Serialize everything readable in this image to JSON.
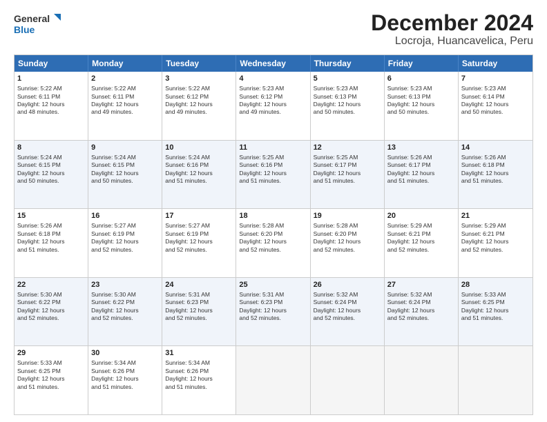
{
  "header": {
    "logo_line1": "General",
    "logo_line2": "Blue",
    "month": "December 2024",
    "location": "Locroja, Huancavelica, Peru"
  },
  "weekdays": [
    "Sunday",
    "Monday",
    "Tuesday",
    "Wednesday",
    "Thursday",
    "Friday",
    "Saturday"
  ],
  "rows": [
    [
      {
        "day": "1",
        "text": "Sunrise: 5:22 AM\nSunset: 6:11 PM\nDaylight: 12 hours\nand 48 minutes."
      },
      {
        "day": "2",
        "text": "Sunrise: 5:22 AM\nSunset: 6:11 PM\nDaylight: 12 hours\nand 49 minutes."
      },
      {
        "day": "3",
        "text": "Sunrise: 5:22 AM\nSunset: 6:12 PM\nDaylight: 12 hours\nand 49 minutes."
      },
      {
        "day": "4",
        "text": "Sunrise: 5:23 AM\nSunset: 6:12 PM\nDaylight: 12 hours\nand 49 minutes."
      },
      {
        "day": "5",
        "text": "Sunrise: 5:23 AM\nSunset: 6:13 PM\nDaylight: 12 hours\nand 50 minutes."
      },
      {
        "day": "6",
        "text": "Sunrise: 5:23 AM\nSunset: 6:13 PM\nDaylight: 12 hours\nand 50 minutes."
      },
      {
        "day": "7",
        "text": "Sunrise: 5:23 AM\nSunset: 6:14 PM\nDaylight: 12 hours\nand 50 minutes."
      }
    ],
    [
      {
        "day": "8",
        "text": "Sunrise: 5:24 AM\nSunset: 6:15 PM\nDaylight: 12 hours\nand 50 minutes."
      },
      {
        "day": "9",
        "text": "Sunrise: 5:24 AM\nSunset: 6:15 PM\nDaylight: 12 hours\nand 50 minutes."
      },
      {
        "day": "10",
        "text": "Sunrise: 5:24 AM\nSunset: 6:16 PM\nDaylight: 12 hours\nand 51 minutes."
      },
      {
        "day": "11",
        "text": "Sunrise: 5:25 AM\nSunset: 6:16 PM\nDaylight: 12 hours\nand 51 minutes."
      },
      {
        "day": "12",
        "text": "Sunrise: 5:25 AM\nSunset: 6:17 PM\nDaylight: 12 hours\nand 51 minutes."
      },
      {
        "day": "13",
        "text": "Sunrise: 5:26 AM\nSunset: 6:17 PM\nDaylight: 12 hours\nand 51 minutes."
      },
      {
        "day": "14",
        "text": "Sunrise: 5:26 AM\nSunset: 6:18 PM\nDaylight: 12 hours\nand 51 minutes."
      }
    ],
    [
      {
        "day": "15",
        "text": "Sunrise: 5:26 AM\nSunset: 6:18 PM\nDaylight: 12 hours\nand 51 minutes."
      },
      {
        "day": "16",
        "text": "Sunrise: 5:27 AM\nSunset: 6:19 PM\nDaylight: 12 hours\nand 52 minutes."
      },
      {
        "day": "17",
        "text": "Sunrise: 5:27 AM\nSunset: 6:19 PM\nDaylight: 12 hours\nand 52 minutes."
      },
      {
        "day": "18",
        "text": "Sunrise: 5:28 AM\nSunset: 6:20 PM\nDaylight: 12 hours\nand 52 minutes."
      },
      {
        "day": "19",
        "text": "Sunrise: 5:28 AM\nSunset: 6:20 PM\nDaylight: 12 hours\nand 52 minutes."
      },
      {
        "day": "20",
        "text": "Sunrise: 5:29 AM\nSunset: 6:21 PM\nDaylight: 12 hours\nand 52 minutes."
      },
      {
        "day": "21",
        "text": "Sunrise: 5:29 AM\nSunset: 6:21 PM\nDaylight: 12 hours\nand 52 minutes."
      }
    ],
    [
      {
        "day": "22",
        "text": "Sunrise: 5:30 AM\nSunset: 6:22 PM\nDaylight: 12 hours\nand 52 minutes."
      },
      {
        "day": "23",
        "text": "Sunrise: 5:30 AM\nSunset: 6:22 PM\nDaylight: 12 hours\nand 52 minutes."
      },
      {
        "day": "24",
        "text": "Sunrise: 5:31 AM\nSunset: 6:23 PM\nDaylight: 12 hours\nand 52 minutes."
      },
      {
        "day": "25",
        "text": "Sunrise: 5:31 AM\nSunset: 6:23 PM\nDaylight: 12 hours\nand 52 minutes."
      },
      {
        "day": "26",
        "text": "Sunrise: 5:32 AM\nSunset: 6:24 PM\nDaylight: 12 hours\nand 52 minutes."
      },
      {
        "day": "27",
        "text": "Sunrise: 5:32 AM\nSunset: 6:24 PM\nDaylight: 12 hours\nand 52 minutes."
      },
      {
        "day": "28",
        "text": "Sunrise: 5:33 AM\nSunset: 6:25 PM\nDaylight: 12 hours\nand 51 minutes."
      }
    ],
    [
      {
        "day": "29",
        "text": "Sunrise: 5:33 AM\nSunset: 6:25 PM\nDaylight: 12 hours\nand 51 minutes."
      },
      {
        "day": "30",
        "text": "Sunrise: 5:34 AM\nSunset: 6:26 PM\nDaylight: 12 hours\nand 51 minutes."
      },
      {
        "day": "31",
        "text": "Sunrise: 5:34 AM\nSunset: 6:26 PM\nDaylight: 12 hours\nand 51 minutes."
      },
      {
        "day": "",
        "text": ""
      },
      {
        "day": "",
        "text": ""
      },
      {
        "day": "",
        "text": ""
      },
      {
        "day": "",
        "text": ""
      }
    ]
  ]
}
